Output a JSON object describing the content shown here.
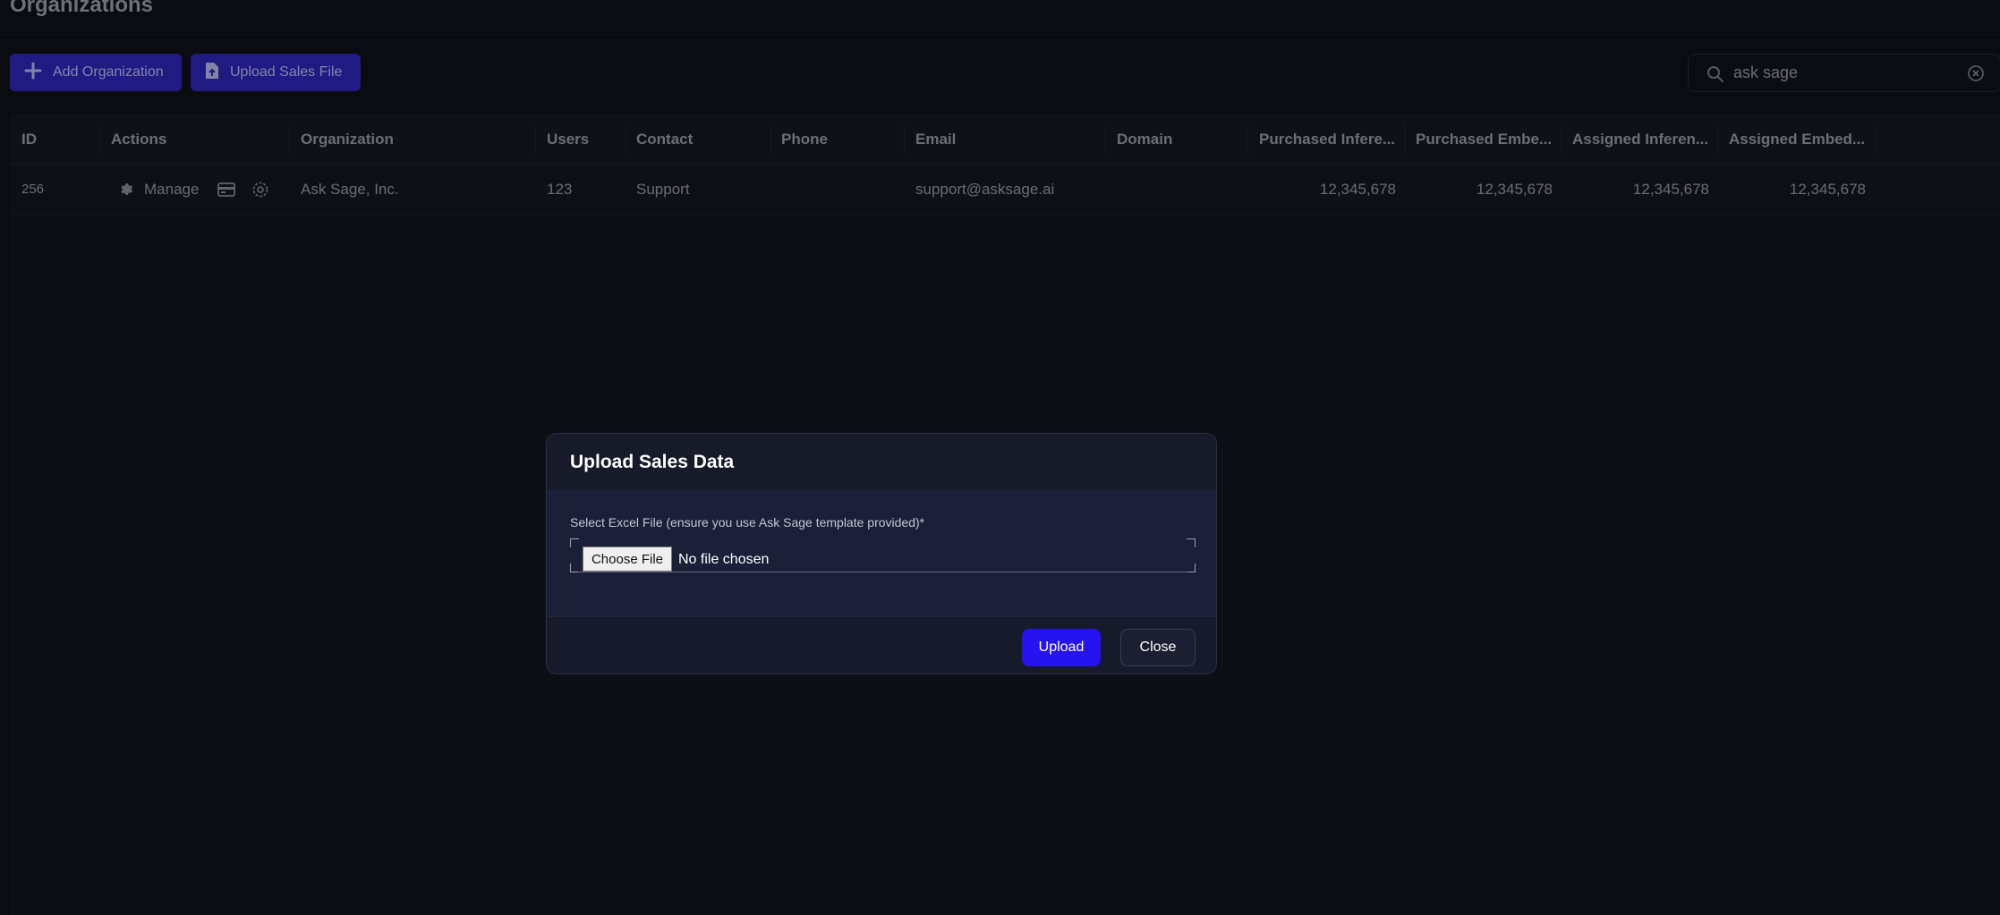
{
  "page": {
    "title": "Organizations"
  },
  "toolbar": {
    "add_label": "Add Organization",
    "upload_label": "Upload Sales File"
  },
  "search": {
    "value": "ask sage"
  },
  "table": {
    "columns": [
      "ID",
      "Actions",
      "Organization",
      "Users",
      "Contact",
      "Phone",
      "Email",
      "Domain",
      "Purchased Infere...",
      "Purchased Embe...",
      "Assigned Inferen...",
      "Assigned Embed..."
    ],
    "rows": [
      {
        "id": "256",
        "manage_label": "Manage",
        "organization": "Ask Sage, Inc.",
        "users": "123",
        "contact": "Support",
        "phone": "",
        "email": "support@asksage.ai",
        "domain": "",
        "purchased_inference": "12,345,678",
        "purchased_embedding": "12,345,678",
        "assigned_inference": "12,345,678",
        "assigned_embedding": "12,345,678"
      }
    ]
  },
  "modal": {
    "title": "Upload Sales Data",
    "field_label": "Select Excel File (ensure you use Ask Sage template provided)*",
    "choose_label": "Choose File",
    "no_file_text": "No file chosen",
    "upload_label": "Upload",
    "close_label": "Close"
  },
  "colors": {
    "background": "#0b0c12",
    "primary_button": "#2513f0",
    "dim_primary_button": "#2a1fa8",
    "modal_body": "#1b1f38"
  }
}
